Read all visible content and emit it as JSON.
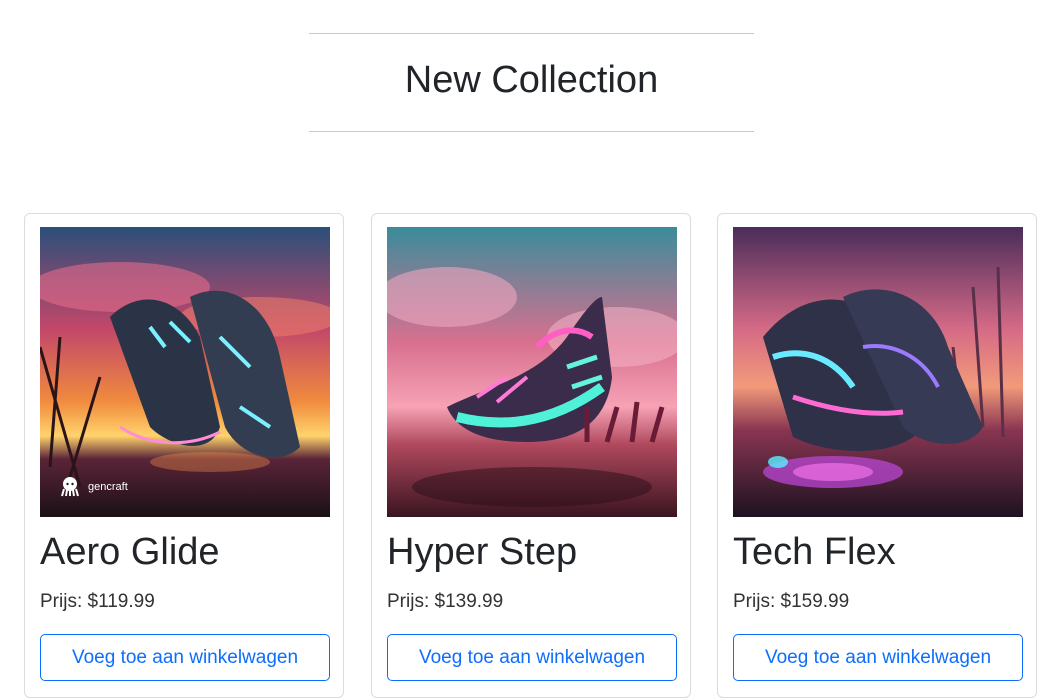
{
  "header": {
    "title": "New Collection"
  },
  "products": [
    {
      "name": "Aero Glide",
      "price": "Prijs: $119.99",
      "button_label": "Voeg toe aan winkelwagen",
      "image_watermark": "gencraft"
    },
    {
      "name": "Hyper Step",
      "price": "Prijs: $139.99",
      "button_label": "Voeg toe aan winkelwagen"
    },
    {
      "name": "Tech Flex",
      "price": "Prijs: $159.99",
      "button_label": "Voeg toe aan winkelwagen"
    }
  ]
}
